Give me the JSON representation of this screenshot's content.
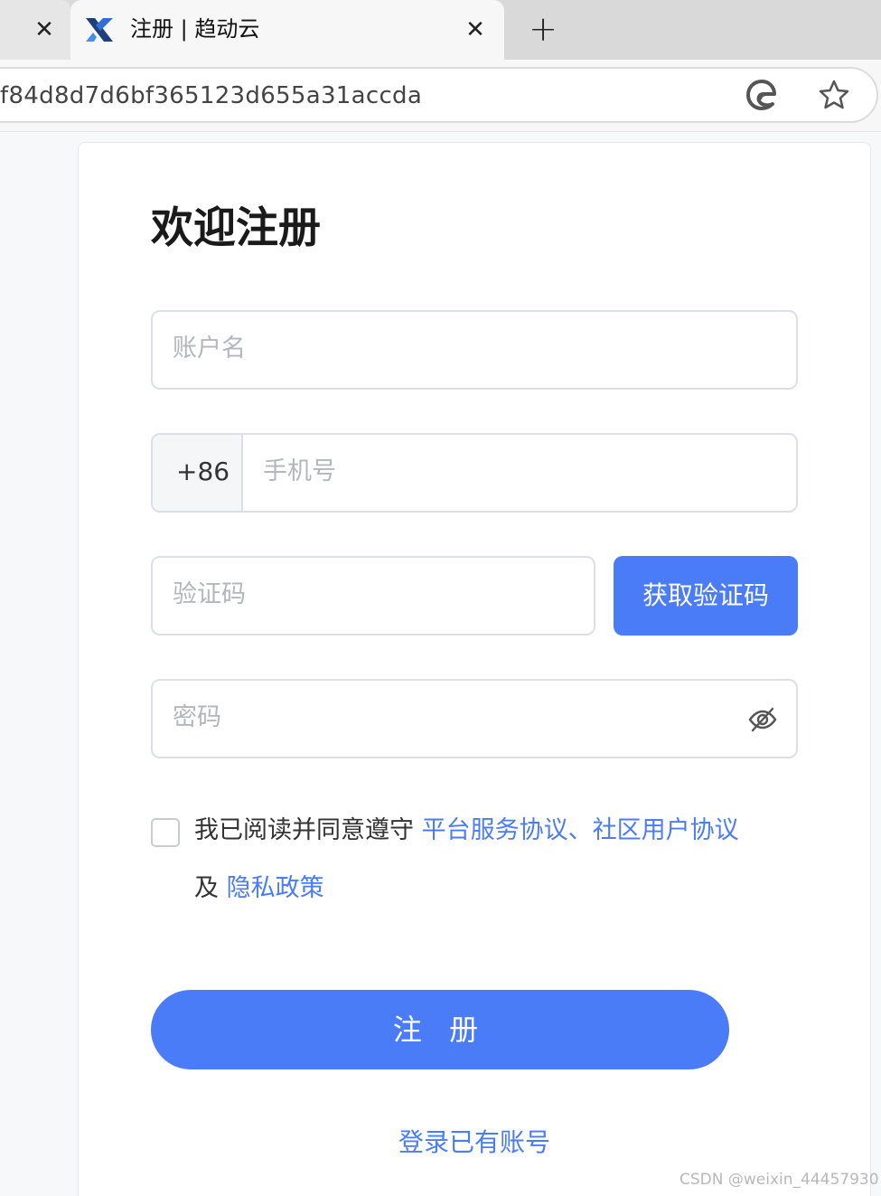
{
  "browser": {
    "active_tab_title": "注册 | 趋动云",
    "address_url": "f84d8d7d6bf365123d655a31accda",
    "icons": {
      "prev_tab_close": "close-icon",
      "tab_favicon": "site-logo-icon",
      "tab_close": "close-icon",
      "new_tab": "plus-icon",
      "edge": "edge-icon",
      "favorite": "star-icon"
    }
  },
  "form": {
    "heading": "欢迎注册",
    "account_placeholder": "账户名",
    "phone_prefix": "+86",
    "phone_placeholder": "手机号",
    "code_placeholder": "验证码",
    "get_code_label": "获取验证码",
    "password_placeholder": "密码",
    "agree_prefix": "我已阅读并同意遵守 ",
    "agree_link_platform": "平台服务协议",
    "agree_sep": "、",
    "agree_link_community": "社区用户协议",
    "agree_and": "及 ",
    "agree_link_privacy": "隐私政策",
    "register_label": "注 册",
    "login_link": "登录已有账号"
  },
  "watermark": "CSDN @weixin_44457930",
  "colors": {
    "primary": "#4a7cf8",
    "placeholder": "#b3b6bc",
    "border": "#dcdfe6"
  }
}
